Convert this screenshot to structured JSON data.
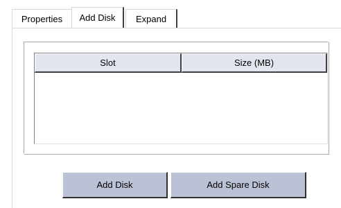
{
  "tabs": {
    "properties": "Properties",
    "add_disk": "Add Disk",
    "expand": "Expand"
  },
  "table": {
    "columns": [
      "Slot",
      "Size (MB)"
    ],
    "rows": []
  },
  "buttons": {
    "add_disk": "Add Disk",
    "add_spare_disk": "Add Spare Disk"
  },
  "colors": {
    "header_bg": "#e3e6ef",
    "button_bg": "#bcc2d6"
  }
}
